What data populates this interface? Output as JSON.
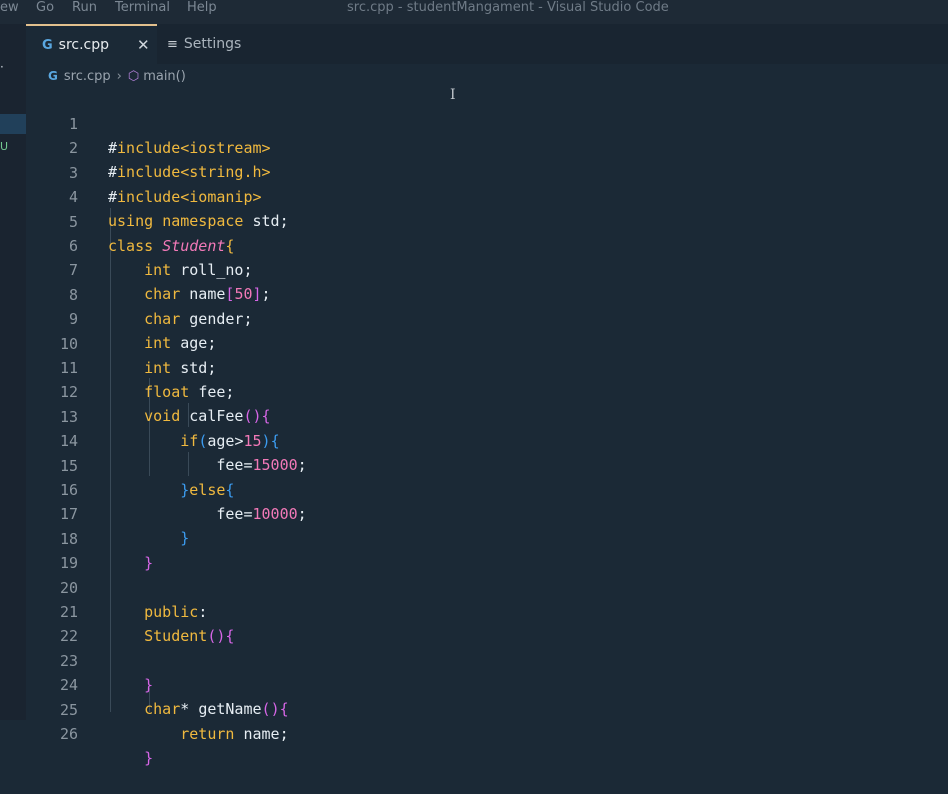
{
  "window": {
    "title": "src.cpp - studentMangament - Visual Studio Code",
    "menu": [
      "ew",
      "Go",
      "Run",
      "Terminal",
      "Help"
    ]
  },
  "sidebar": {
    "dot": "·",
    "badge": "U"
  },
  "tabs": [
    {
      "label": "src.cpp",
      "icon": "c-plus-plus-file-icon",
      "active": true
    },
    {
      "label": "Settings",
      "icon": "settings-list-icon",
      "active": false
    }
  ],
  "breadcrumb": {
    "file": "src.cpp",
    "symbol": "main()"
  },
  "editor": {
    "line_numbers": [
      "1",
      "2",
      "3",
      "4",
      "5",
      "6",
      "7",
      "8",
      "9",
      "10",
      "11",
      "12",
      "13",
      "14",
      "15",
      "16",
      "17",
      "18",
      "19",
      "20",
      "21",
      "22",
      "23",
      "24",
      "25",
      "26"
    ],
    "lines": [
      "#include<iostream>",
      "#include<string.h>",
      "#include<iomanip>",
      "using namespace std;",
      "class Student{",
      "    int roll_no;",
      "    char name[50];",
      "    char gender;",
      "    int age;",
      "    int std;",
      "    float fee;",
      "    void calFee(){",
      "        if(age>15){",
      "            fee=15000;",
      "        }else{",
      "            fee=10000;",
      "        }",
      "    }",
      "",
      "    public:",
      "    Student(){",
      "",
      "    }",
      "    char* getName(){",
      "        return name;",
      "    }"
    ]
  },
  "colors": {
    "background": "#1b2936",
    "keyword": "#f0b93f",
    "number": "#f279b8",
    "bracket_level2": "#d666e6",
    "bracket_level3": "#3c9cf0"
  }
}
